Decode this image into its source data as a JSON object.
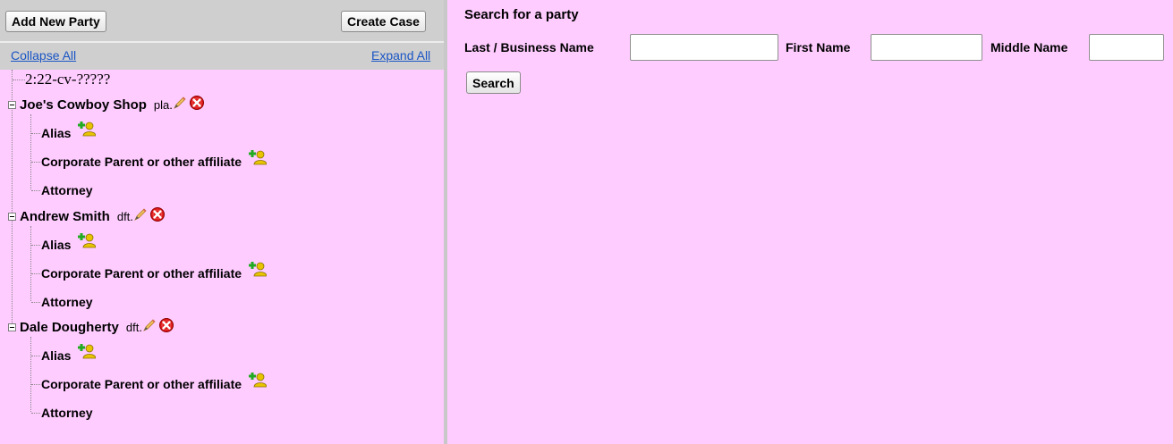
{
  "toolbar": {
    "add_new_party_label": "Add New Party",
    "create_case_label": "Create Case"
  },
  "tree_controls": {
    "collapse_all_label": "Collapse All",
    "expand_all_label": "Expand All"
  },
  "case_number": "2:22-cv-?????",
  "parties": [
    {
      "name": "Joe's Cowboy Shop",
      "role": "pla.",
      "children": [
        "Alias",
        "Corporate Parent or other affiliate",
        "Attorney"
      ]
    },
    {
      "name": "Andrew Smith",
      "role": "dft.",
      "children": [
        "Alias",
        "Corporate Parent or other affiliate",
        "Attorney"
      ]
    },
    {
      "name": "Dale Dougherty",
      "role": "dft.",
      "children": [
        "Alias",
        "Corporate Parent or other affiliate",
        "Attorney"
      ]
    }
  ],
  "search": {
    "title": "Search for a party",
    "last_name_label": "Last / Business Name",
    "last_name_value": "",
    "first_name_label": "First Name",
    "first_name_value": "",
    "middle_name_label": "Middle Name",
    "middle_name_value": "",
    "search_button_label": "Search"
  },
  "icons": {
    "edit": "pencil-icon",
    "delete": "delete-icon",
    "add": "add-person-icon",
    "collapse": "minus-box-icon"
  },
  "colors": {
    "page_background": "#ffccff",
    "toolbar_background": "#cfcfcf",
    "link": "#1a55c4",
    "delete_red": "#e01818",
    "add_green": "#22aa22",
    "add_yellow": "#e8c400"
  }
}
